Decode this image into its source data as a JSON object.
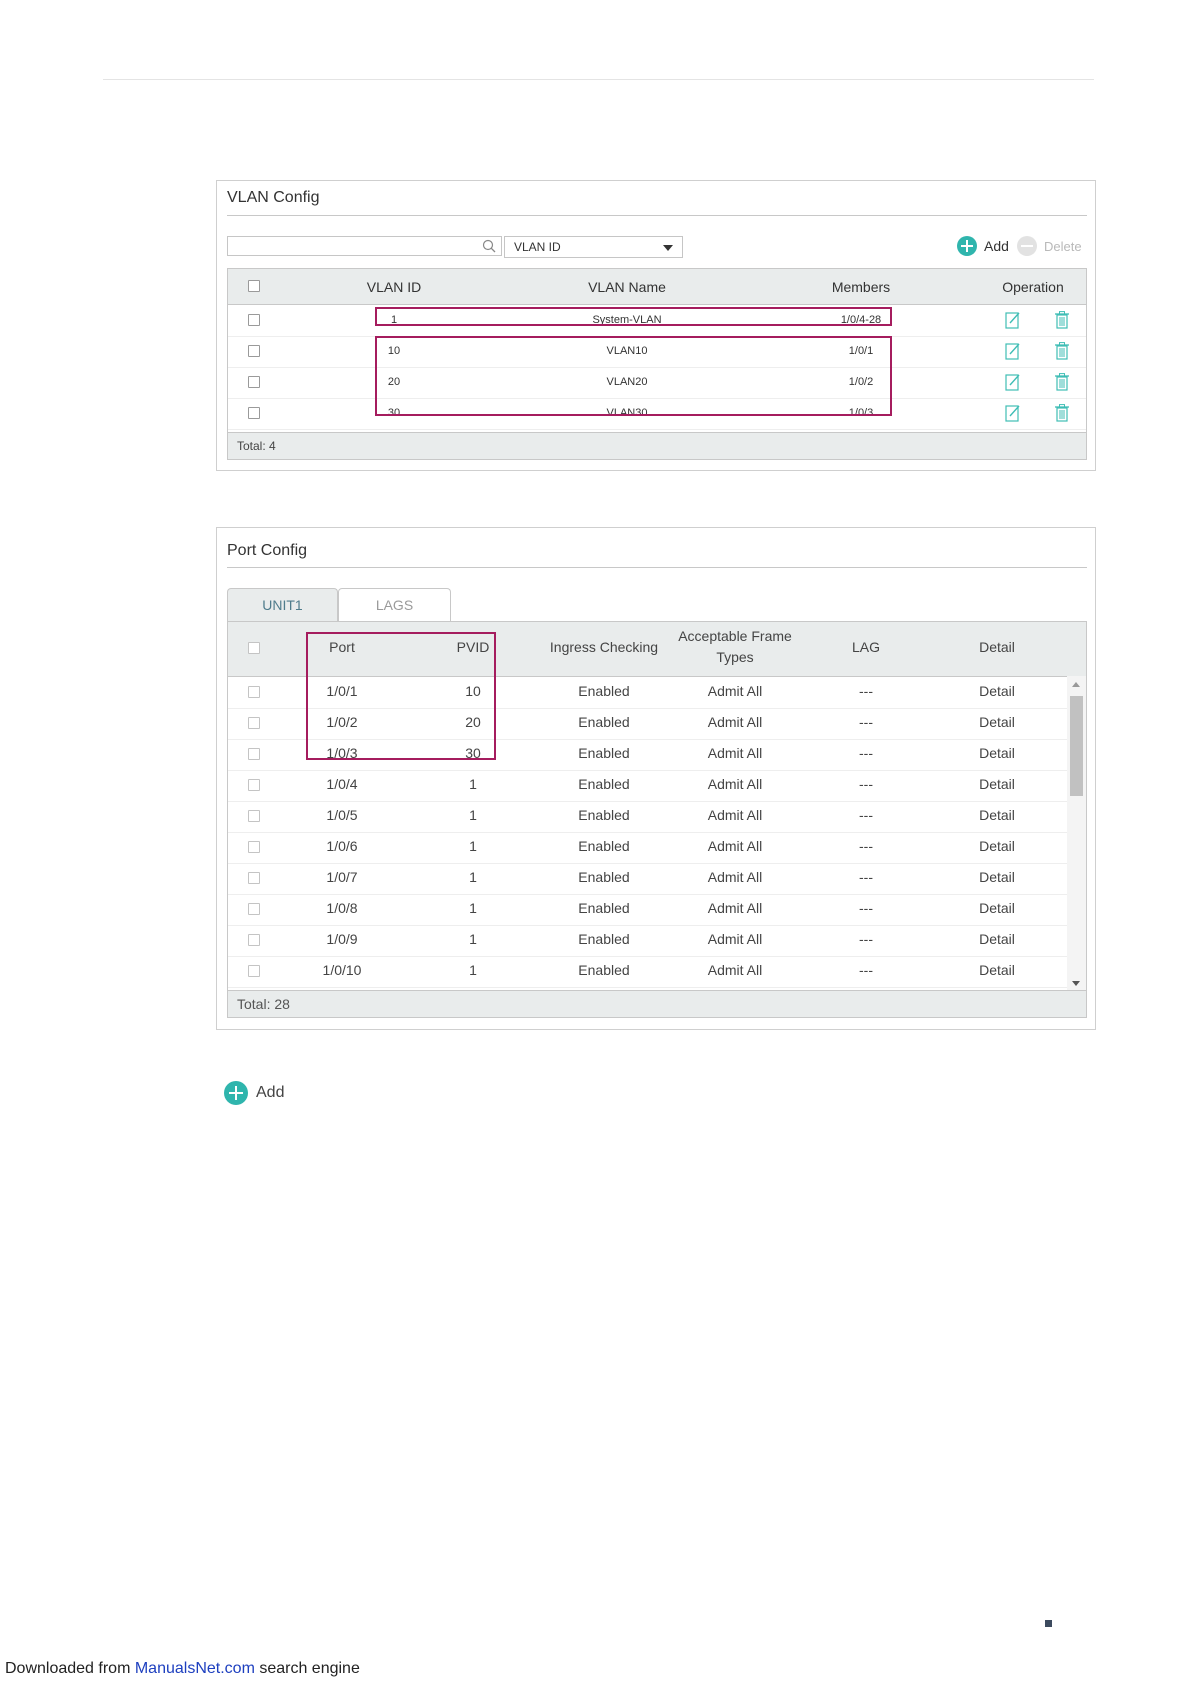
{
  "vlan_config": {
    "title": "VLAN Config",
    "search": {
      "value": "",
      "placeholder": ""
    },
    "search_field_select": "VLAN ID",
    "add_label": "Add",
    "delete_label": "Delete",
    "columns": [
      "VLAN ID",
      "VLAN Name",
      "Members",
      "Operation"
    ],
    "rows": [
      {
        "vlan_id": "1",
        "vlan_name": "System-VLAN",
        "members": "1/0/4-28"
      },
      {
        "vlan_id": "10",
        "vlan_name": "VLAN10",
        "members": "1/0/1"
      },
      {
        "vlan_id": "20",
        "vlan_name": "VLAN20",
        "members": "1/0/2"
      },
      {
        "vlan_id": "30",
        "vlan_name": "VLAN30",
        "members": "1/0/3"
      }
    ],
    "total": "Total: 4",
    "edit_icon": "edit-icon",
    "delete_icon": "trash-icon"
  },
  "port_config": {
    "title": "Port Config",
    "tabs": [
      "UNIT1",
      "LAGS"
    ],
    "active_tab": "UNIT1",
    "columns": [
      "Port",
      "PVID",
      "Ingress Checking",
      "Acceptable Frame Types",
      "LAG",
      "Detail"
    ],
    "frame_types_header": [
      "Acceptable Frame",
      "Types"
    ],
    "rows": [
      {
        "port": "1/0/1",
        "pvid": "10",
        "ingress": "Enabled",
        "frame_types": "Admit All",
        "lag": "---",
        "detail": "Detail"
      },
      {
        "port": "1/0/2",
        "pvid": "20",
        "ingress": "Enabled",
        "frame_types": "Admit All",
        "lag": "---",
        "detail": "Detail"
      },
      {
        "port": "1/0/3",
        "pvid": "30",
        "ingress": "Enabled",
        "frame_types": "Admit All",
        "lag": "---",
        "detail": "Detail"
      },
      {
        "port": "1/0/4",
        "pvid": "1",
        "ingress": "Enabled",
        "frame_types": "Admit All",
        "lag": "---",
        "detail": "Detail"
      },
      {
        "port": "1/0/5",
        "pvid": "1",
        "ingress": "Enabled",
        "frame_types": "Admit All",
        "lag": "---",
        "detail": "Detail"
      },
      {
        "port": "1/0/6",
        "pvid": "1",
        "ingress": "Enabled",
        "frame_types": "Admit All",
        "lag": "---",
        "detail": "Detail"
      },
      {
        "port": "1/0/7",
        "pvid": "1",
        "ingress": "Enabled",
        "frame_types": "Admit All",
        "lag": "---",
        "detail": "Detail"
      },
      {
        "port": "1/0/8",
        "pvid": "1",
        "ingress": "Enabled",
        "frame_types": "Admit All",
        "lag": "---",
        "detail": "Detail"
      },
      {
        "port": "1/0/9",
        "pvid": "1",
        "ingress": "Enabled",
        "frame_types": "Admit All",
        "lag": "---",
        "detail": "Detail"
      },
      {
        "port": "1/0/10",
        "pvid": "1",
        "ingress": "Enabled",
        "frame_types": "Admit All",
        "lag": "---",
        "detail": "Detail"
      }
    ],
    "total": "Total: 28"
  },
  "bottom_add_label": "Add",
  "footer": {
    "prefix": "Downloaded from ",
    "link": "ManualsNet.com",
    "suffix": " search engine"
  },
  "colors": {
    "accent": "#2fb5ad",
    "highlight": "#a51c5e",
    "link": "#1d3fbf",
    "header_bg": "#e9ecec"
  }
}
